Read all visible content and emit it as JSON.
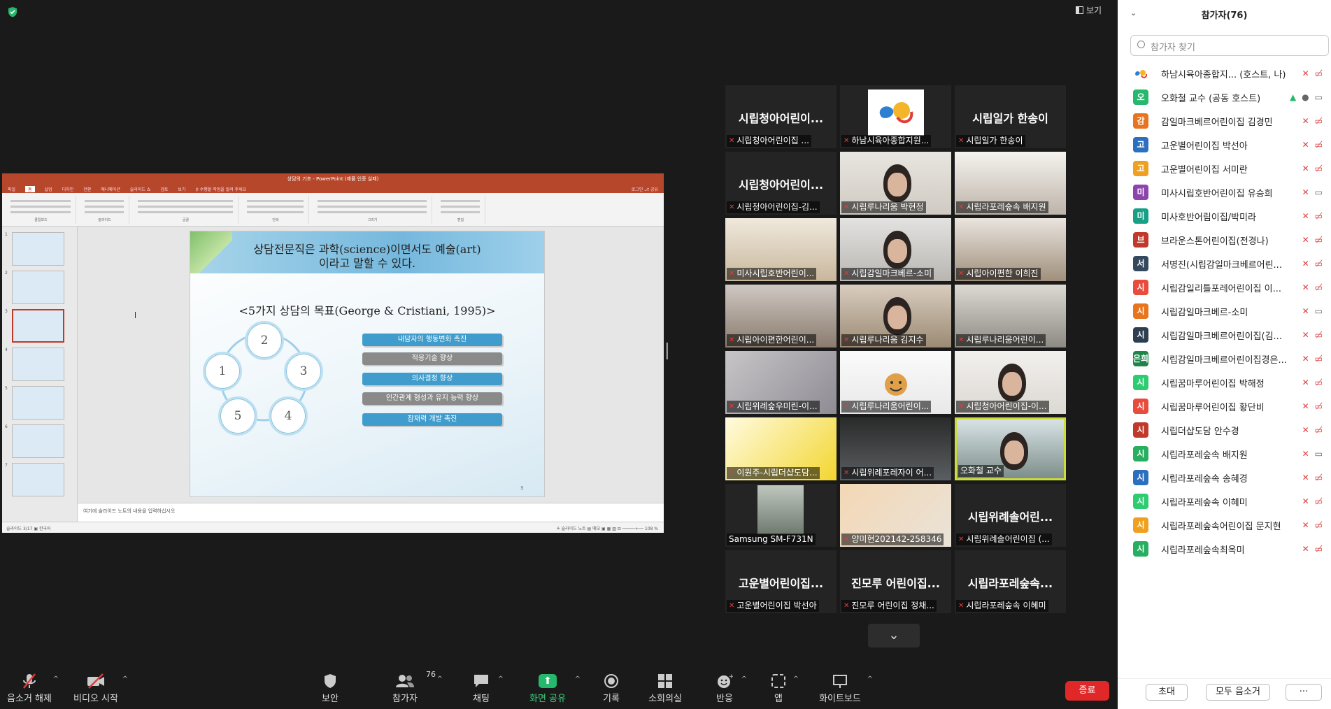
{
  "colors": {
    "accent_green": "#26b86c",
    "end_red": "#e02828",
    "muted_red": "#e03c3c",
    "active_speaker": "#cddc39",
    "ppt_red": "#b7472a"
  },
  "top": {
    "view_label": "보기",
    "shield_icon": "shield-check-icon"
  },
  "presentation": {
    "window_title": "상담의 기초 - PowerPoint (제품 인증 실패)",
    "tabs": [
      "파일",
      "홈",
      "삽입",
      "디자인",
      "전환",
      "애니메이션",
      "슬라이드 쇼",
      "검토",
      "보기",
      "♀ 수행할 작업을 알려 주세요"
    ],
    "user": "로그인  ⎇ 공유",
    "ribbon_groups": [
      "클립보드",
      "슬라이드",
      "글꼴",
      "단락",
      "그리기",
      "편집"
    ],
    "slide": {
      "line1": "상담전문직은 과학(science)이면서도 예술(art)",
      "line2": "이라고 말할 수 있다.",
      "subtitle": "<5가지 상담의 목표(George & Cristiani, 1995)>",
      "circles": [
        "1",
        "2",
        "3",
        "4",
        "5"
      ],
      "goals": [
        "내담자의 행동변화 촉진",
        "적응기술 향상",
        "의사결정 향상",
        "인간관계 형성과 유지 능력 향상",
        "잠재력 개발 촉진"
      ],
      "page_number": "3"
    },
    "thumb_numbers": [
      "1",
      "2",
      "3",
      "4",
      "5",
      "6",
      "7"
    ],
    "notes_placeholder": "여기에 슬라이드 노트의 내용을 입력하십시오",
    "status": "슬라이드 3/17   ▣  한국어",
    "status_right": "≗ 슬라이드 노트   ▤ 메모      ▣  ▦  ▥  ⊟   ─────+──   108 %"
  },
  "gallery": [
    {
      "big": "시립청아어린이...",
      "label": "시립청아어린이집 ..."
    },
    {
      "big": "",
      "label": "하남시육아종합지원..."
    },
    {
      "big": "시립일가 한송이",
      "label": "시립일가 한송이"
    },
    {
      "big": "시립청아어린이...",
      "label": "시립청아어린이집-김..."
    },
    {
      "big": "",
      "label": "시립루나리움 박현정"
    },
    {
      "big": "",
      "label": "시립라포레숲속 배지원"
    },
    {
      "big": "",
      "label": "미사시립호반어린이..."
    },
    {
      "big": "",
      "label": "시립감일마크베르-소미"
    },
    {
      "big": "",
      "label": "시립아이편한 이희진"
    },
    {
      "big": "",
      "label": "시립아이편한어린이..."
    },
    {
      "big": "",
      "label": "시립루나리움 김지수"
    },
    {
      "big": "",
      "label": "시립루나리움어린이..."
    },
    {
      "big": "",
      "label": "시립위례숲우미린-이..."
    },
    {
      "big": "",
      "label": "시립루나리움어린이..."
    },
    {
      "big": "",
      "label": "시립청아어린이집-이..."
    },
    {
      "big": "",
      "label": "이원주-시립더샵도담..."
    },
    {
      "big": "",
      "label": "시립위례포레자이 어..."
    },
    {
      "big": "",
      "label": "오화철 교수"
    },
    {
      "big": "",
      "label": "Samsung SM-F731N"
    },
    {
      "big": "",
      "label": "양미현202142-258346"
    },
    {
      "big": "시립위례솔어린...",
      "label": "시립위례솔어린이집 (..."
    },
    {
      "big": "고운별어린이집...",
      "label": "고운별어린이집 박선아"
    },
    {
      "big": "진모루 어린이집...",
      "label": "진모루 어린이집 정채..."
    },
    {
      "big": "시립라포레숲속...",
      "label": "시립라포레숲속 이혜미"
    }
  ],
  "toolbar": {
    "unmute": "음소거 해제",
    "start_video": "비디오 시작",
    "security": "보안",
    "participants": "참가자",
    "participant_count": "76",
    "chat": "채팅",
    "share": "화면 공유",
    "record": "기록",
    "breakout": "소회의실",
    "reactions": "반응",
    "apps": "앱",
    "whiteboard": "화이트보드",
    "end": "종료"
  },
  "panel": {
    "title": "참가자(76)",
    "search_placeholder": "참가자 찾기",
    "invite": "초대",
    "mute_all": "모두 음소거",
    "more": "···",
    "participants": [
      {
        "initial": "",
        "name": "하남시육아종합지... (호스트, 나)",
        "color": "#ffffff",
        "video": "off"
      },
      {
        "initial": "오",
        "name": "오화철 교수 (공동 호스트)",
        "color": "#26b86c",
        "video": "on"
      },
      {
        "initial": "감",
        "name": "감일마크베르어린이집 김경민",
        "color": "#e8741f",
        "video": "off"
      },
      {
        "initial": "고",
        "name": "고운별어린이집 박선아",
        "color": "#2d6fbf",
        "video": "off"
      },
      {
        "initial": "고",
        "name": "고운별어린이집 서미란",
        "color": "#f0a020",
        "video": "off"
      },
      {
        "initial": "미",
        "name": "미사시립호반어린이집 유승희",
        "color": "#8e44ad",
        "video": "on"
      },
      {
        "initial": "미",
        "name": "미사호반어림이집/박미라",
        "color": "#16a085",
        "video": "off"
      },
      {
        "initial": "브",
        "name": "브라운스톤어린이집(전경나)",
        "color": "#c0392b",
        "video": "off"
      },
      {
        "initial": "서",
        "name": "서명진(시립감일마크베르어린...",
        "color": "#34495e",
        "video": "off"
      },
      {
        "initial": "시",
        "name": "시립감일리틀포레어린이집 이...",
        "color": "#e74c3c",
        "video": "off"
      },
      {
        "initial": "시",
        "name": "시립감일마크베르-소미",
        "color": "#e8741f",
        "video": "on"
      },
      {
        "initial": "시",
        "name": "시립감일마크베르어린이집(김...",
        "color": "#2c3e50",
        "video": "off"
      },
      {
        "initial": "은희",
        "name": "시립감일마크베르어린이집경은...",
        "color": "#1e8449",
        "video": "off"
      },
      {
        "initial": "시",
        "name": "시립꿈마루어린이집 박해정",
        "color": "#2ecc71",
        "video": "off"
      },
      {
        "initial": "시",
        "name": "시립꿈마루어린이집 황단비",
        "color": "#e74c3c",
        "video": "off"
      },
      {
        "initial": "시",
        "name": "시립더샵도담 안수경",
        "color": "#c0392b",
        "video": "off"
      },
      {
        "initial": "시",
        "name": "시립라포레숲속 배지원",
        "color": "#27ae60",
        "video": "on"
      },
      {
        "initial": "시",
        "name": "시립라포레숲속 송혜경",
        "color": "#2d6fbf",
        "video": "off"
      },
      {
        "initial": "시",
        "name": "시립라포레숲속 이혜미",
        "color": "#2ecc71",
        "video": "off"
      },
      {
        "initial": "시",
        "name": "시립라포레숲속어린이집 문지현",
        "color": "#f0a020",
        "video": "off"
      },
      {
        "initial": "시",
        "name": "시립라포레숲속최옥미",
        "color": "#27ae60",
        "video": "off"
      }
    ]
  }
}
